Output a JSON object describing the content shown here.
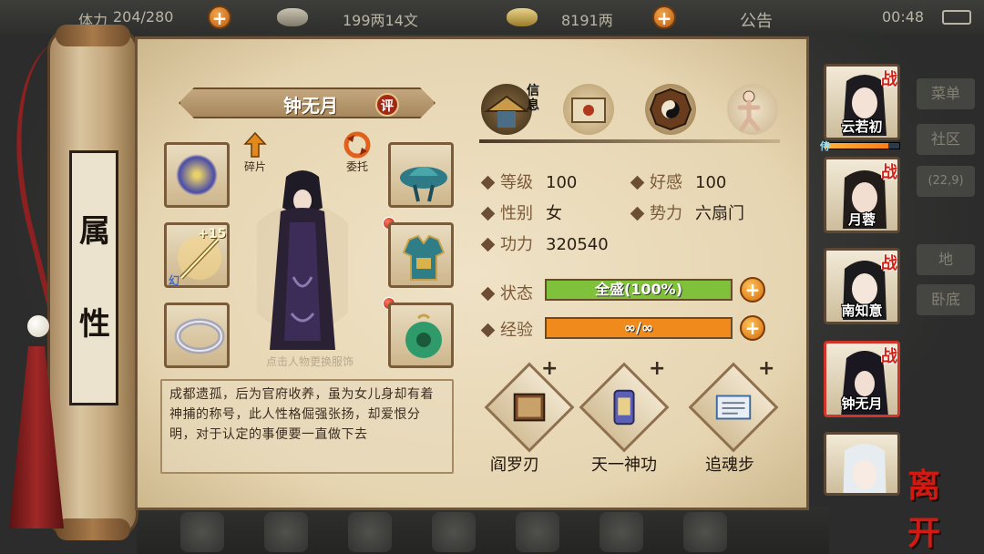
{
  "topbar": {
    "stamina_label": "体力",
    "stamina_value": "204/280",
    "silver_value": "199两14文",
    "gold_value": "8191两",
    "notice_label": "公告",
    "clock": "00:48"
  },
  "background_menu": {
    "items": [
      "菜单",
      "社区",
      "(22,9)",
      "地",
      "卧底"
    ]
  },
  "side_tab": {
    "chars": [
      "属",
      "性"
    ]
  },
  "hero": {
    "name": "钟无月",
    "review_badge": "评",
    "fragment_label": "碎片",
    "delegate_label": "委托",
    "hint": "点击人物更换服饰",
    "description": "成都遗孤，后为官府收养，虽为女儿身却有着神捕的称号，此人性格倔强张扬，却爱恨分明，对于认定的事便要一直做下去"
  },
  "equipment": {
    "weapon_level": "+15",
    "weapon_tag": "幻"
  },
  "tabs": {
    "info_label": "信息",
    "icons": [
      "bamboo-hat-icon",
      "scroll-icon",
      "bagua-icon",
      "meridian-icon"
    ]
  },
  "stats": {
    "level_label": "等级",
    "level": "100",
    "favor_label": "好感",
    "favor": "100",
    "gender_label": "性别",
    "gender": "女",
    "faction_label": "势力",
    "faction": "六扇门",
    "power_label": "功力",
    "power": "320540",
    "status_label": "状态",
    "status_value": "全盛(100%)",
    "status_fill": 1.0,
    "exp_label": "经验",
    "exp_value": "∞/∞",
    "exp_fill": 1.0
  },
  "skills": [
    {
      "name": "阎罗刃"
    },
    {
      "name": "天一神功"
    },
    {
      "name": "追魂步"
    }
  ],
  "roster": [
    {
      "name": "云若初",
      "badge": "战",
      "hp": 0.85,
      "hp_tag": "侍"
    },
    {
      "name": "月蓉",
      "badge": "战"
    },
    {
      "name": "南知意",
      "badge": "战"
    },
    {
      "name": "钟无月",
      "badge": "战",
      "active": true
    },
    {
      "name": ""
    }
  ],
  "leave_label": "离开",
  "colors": {
    "status_bar": "#7fc13a",
    "exp_bar": "#f08a1c",
    "accent_red": "#d61f14"
  }
}
